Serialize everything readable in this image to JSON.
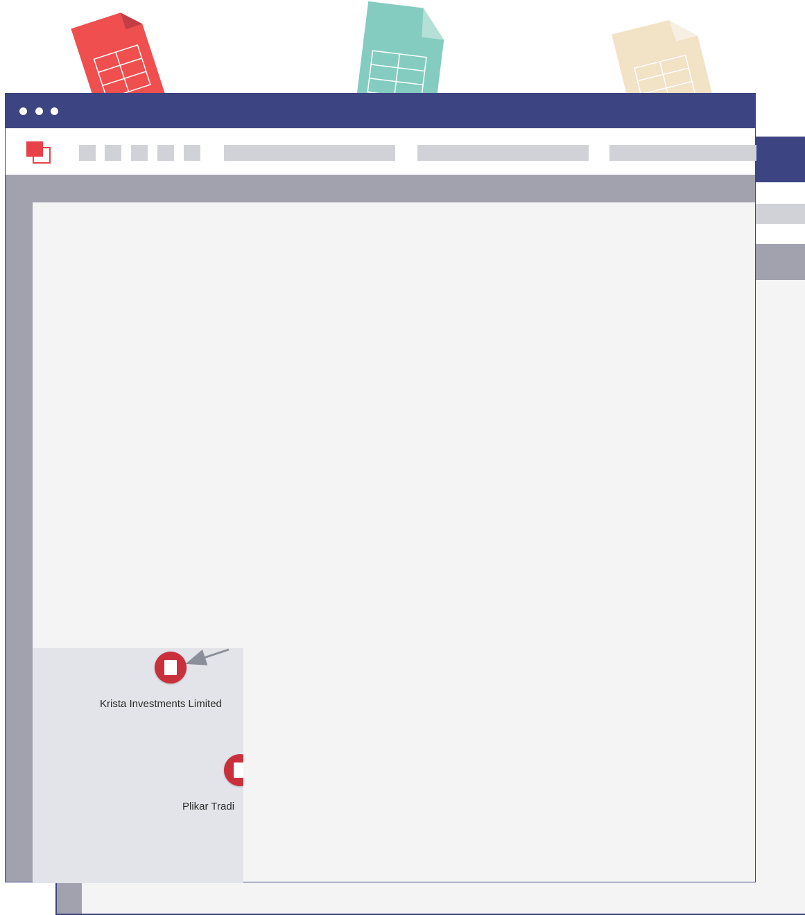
{
  "colors": {
    "title_bar": "#3c4482",
    "placeholder_light": "#d1d2d8",
    "placeholder_dark": "#a2a2ae",
    "canvas": "#f4f4f4",
    "graph_bg": "#e2e4e9",
    "node_red": "#c9303c",
    "doc_red": "#f04f4f",
    "doc_teal": "#84ccc0",
    "doc_beige": "#f2e2c6"
  },
  "icons": {
    "documents": [
      "spreadsheet-red-icon",
      "spreadsheet-teal-icon",
      "spreadsheet-beige-icon"
    ],
    "window_controls": [
      "window-dot-icon",
      "window-dot-icon",
      "window-dot-icon"
    ],
    "logo": "app-logo-icon",
    "node": "building-icon"
  },
  "graph": {
    "nodes": [
      {
        "label": "Krista Investments Limited",
        "icon": "building-icon"
      },
      {
        "label": "Plikar Tradi",
        "icon": "building-icon"
      }
    ]
  }
}
